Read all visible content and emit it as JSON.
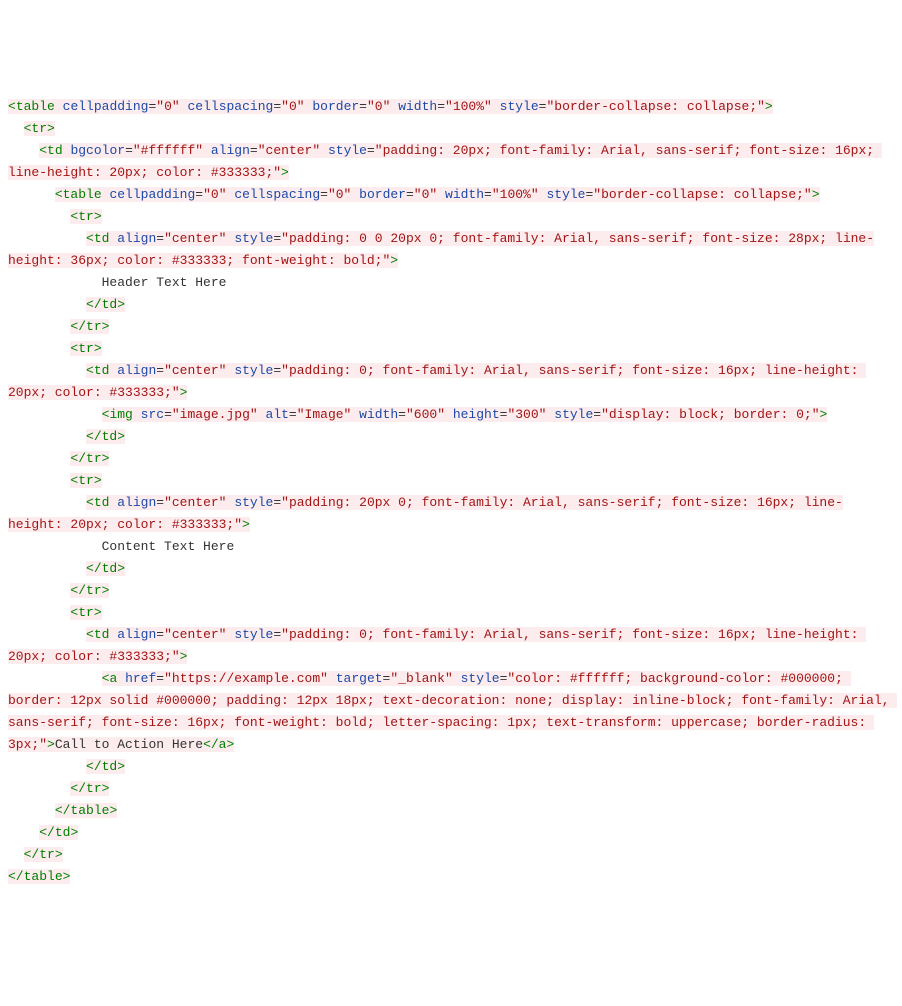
{
  "code": {
    "lines": [
      {
        "i": "",
        "p": [
          [
            "hl",
            "<",
            "tag"
          ],
          [
            "hl",
            "table",
            "tag"
          ],
          [
            "hl",
            " ",
            "txt"
          ],
          [
            "hl",
            "cellpadding",
            "attr"
          ],
          [
            "hl",
            "=",
            "txt"
          ],
          [
            "hl",
            "\"0\"",
            "val"
          ],
          [
            "hl",
            " ",
            "txt"
          ],
          [
            "hl",
            "cellspacing",
            "attr"
          ],
          [
            "hl",
            "=",
            "txt"
          ],
          [
            "hl",
            "\"0\"",
            "val"
          ],
          [
            "hl",
            " ",
            "txt"
          ],
          [
            "hl",
            "border",
            "attr"
          ],
          [
            "hl",
            "=",
            "txt"
          ],
          [
            "hl",
            "\"0\"",
            "val"
          ],
          [
            "hl",
            " ",
            "txt"
          ],
          [
            "hl",
            "width",
            "attr"
          ],
          [
            "hl",
            "=",
            "txt"
          ],
          [
            "hl",
            "\"100%\"",
            "val"
          ],
          [
            "hl",
            " ",
            "txt"
          ],
          [
            "hl",
            "style",
            "attr"
          ],
          [
            "hl",
            "=",
            "txt"
          ],
          [
            "hl",
            "\"border-collapse: collapse;\"",
            "val"
          ],
          [
            "hl",
            ">",
            "tag"
          ]
        ]
      },
      {
        "i": "  ",
        "p": [
          [
            "hl",
            "<",
            "tag"
          ],
          [
            "hl",
            "tr",
            "tag"
          ],
          [
            "hl",
            ">",
            "tag"
          ]
        ]
      },
      {
        "i": "    ",
        "p": [
          [
            "hl",
            "<",
            "tag"
          ],
          [
            "hl",
            "td",
            "tag"
          ],
          [
            "hl",
            " ",
            "txt"
          ],
          [
            "hl",
            "bgcolor",
            "attr"
          ],
          [
            "hl",
            "=",
            "txt"
          ],
          [
            "hl",
            "\"#ffffff\"",
            "val"
          ],
          [
            "hl",
            " ",
            "txt"
          ],
          [
            "hl",
            "align",
            "attr"
          ],
          [
            "hl",
            "=",
            "txt"
          ],
          [
            "hl",
            "\"center\"",
            "val"
          ],
          [
            "hl",
            " ",
            "txt"
          ],
          [
            "hl",
            "style",
            "attr"
          ],
          [
            "hl",
            "=",
            "txt"
          ],
          [
            "hl",
            "\"padding: 20px; font-family: Arial, sans-serif; font-size: 16px; line-height: 20px; color: #333333;\"",
            "val"
          ],
          [
            "hl",
            ">",
            "tag"
          ]
        ]
      },
      {
        "i": "      ",
        "p": [
          [
            "hl",
            "<",
            "tag"
          ],
          [
            "hl",
            "table",
            "tag"
          ],
          [
            "hl",
            " ",
            "txt"
          ],
          [
            "hl",
            "cellpadding",
            "attr"
          ],
          [
            "hl",
            "=",
            "txt"
          ],
          [
            "hl",
            "\"0\"",
            "val"
          ],
          [
            "hl",
            " ",
            "txt"
          ],
          [
            "hl",
            "cellspacing",
            "attr"
          ],
          [
            "hl",
            "=",
            "txt"
          ],
          [
            "hl",
            "\"0\"",
            "val"
          ],
          [
            "hl",
            " ",
            "txt"
          ],
          [
            "hl",
            "border",
            "attr"
          ],
          [
            "hl",
            "=",
            "txt"
          ],
          [
            "hl",
            "\"0\"",
            "val"
          ],
          [
            "hl",
            " ",
            "txt"
          ],
          [
            "hl",
            "width",
            "attr"
          ],
          [
            "hl",
            "=",
            "txt"
          ],
          [
            "hl",
            "\"100%\"",
            "val"
          ],
          [
            "hl",
            " ",
            "txt"
          ],
          [
            "hl",
            "style",
            "attr"
          ],
          [
            "hl",
            "=",
            "txt"
          ],
          [
            "hl",
            "\"border-collapse: collapse;\"",
            "val"
          ],
          [
            "hl",
            ">",
            "tag"
          ]
        ]
      },
      {
        "i": "        ",
        "p": [
          [
            "hl",
            "<",
            "tag"
          ],
          [
            "hl",
            "tr",
            "tag"
          ],
          [
            "hl",
            ">",
            "tag"
          ]
        ]
      },
      {
        "i": "          ",
        "p": [
          [
            "hl",
            "<",
            "tag"
          ],
          [
            "hl",
            "td",
            "tag"
          ],
          [
            "hl",
            " ",
            "txt"
          ],
          [
            "hl",
            "align",
            "attr"
          ],
          [
            "hl",
            "=",
            "txt"
          ],
          [
            "hl",
            "\"center\"",
            "val"
          ],
          [
            "hl",
            " ",
            "txt"
          ],
          [
            "hl",
            "style",
            "attr"
          ],
          [
            "hl",
            "=",
            "txt"
          ],
          [
            "hl",
            "\"padding: 0 0 20px 0; font-family: Arial, sans-serif; font-size: 28px; line-height: 36px; color: #333333; font-weight: bold;\"",
            "val"
          ],
          [
            "hl",
            ">",
            "tag"
          ]
        ]
      },
      {
        "i": "            ",
        "p": [
          [
            "",
            "Header Text Here",
            "txt"
          ]
        ]
      },
      {
        "i": "          ",
        "p": [
          [
            "hl",
            "</",
            "tag"
          ],
          [
            "hl",
            "td",
            "tag"
          ],
          [
            "hl",
            ">",
            "tag"
          ]
        ]
      },
      {
        "i": "        ",
        "p": [
          [
            "hl",
            "</",
            "tag"
          ],
          [
            "hl",
            "tr",
            "tag"
          ],
          [
            "hl",
            ">",
            "tag"
          ]
        ]
      },
      {
        "i": "        ",
        "p": [
          [
            "hl",
            "<",
            "tag"
          ],
          [
            "hl",
            "tr",
            "tag"
          ],
          [
            "hl",
            ">",
            "tag"
          ]
        ]
      },
      {
        "i": "          ",
        "p": [
          [
            "hl",
            "<",
            "tag"
          ],
          [
            "hl",
            "td",
            "tag"
          ],
          [
            "hl",
            " ",
            "txt"
          ],
          [
            "hl",
            "align",
            "attr"
          ],
          [
            "hl",
            "=",
            "txt"
          ],
          [
            "hl",
            "\"center\"",
            "val"
          ],
          [
            "hl",
            " ",
            "txt"
          ],
          [
            "hl",
            "style",
            "attr"
          ],
          [
            "hl",
            "=",
            "txt"
          ],
          [
            "hl",
            "\"padding: 0; font-family: Arial, sans-serif; font-size: 16px; line-height: 20px; color: #333333;\"",
            "val"
          ],
          [
            "hl",
            ">",
            "tag"
          ]
        ]
      },
      {
        "i": "            ",
        "p": [
          [
            "hl",
            "<",
            "tag"
          ],
          [
            "hl",
            "img",
            "tag"
          ],
          [
            "hl",
            " ",
            "txt"
          ],
          [
            "hl",
            "src",
            "attr"
          ],
          [
            "hl",
            "=",
            "txt"
          ],
          [
            "hl",
            "\"image.jpg\"",
            "val"
          ],
          [
            "hl",
            " ",
            "txt"
          ],
          [
            "hl",
            "alt",
            "attr"
          ],
          [
            "hl",
            "=",
            "txt"
          ],
          [
            "hl",
            "\"Image\"",
            "val"
          ],
          [
            "hl",
            " ",
            "txt"
          ],
          [
            "hl",
            "width",
            "attr"
          ],
          [
            "hl",
            "=",
            "txt"
          ],
          [
            "hl",
            "\"600\"",
            "val"
          ],
          [
            "hl",
            " ",
            "txt"
          ],
          [
            "hl",
            "height",
            "attr"
          ],
          [
            "hl",
            "=",
            "txt"
          ],
          [
            "hl",
            "\"300\"",
            "val"
          ],
          [
            "hl",
            " ",
            "txt"
          ],
          [
            "hl",
            "style",
            "attr"
          ],
          [
            "hl",
            "=",
            "txt"
          ],
          [
            "hl",
            "\"display: block; border: 0;\"",
            "val"
          ],
          [
            "hl",
            ">",
            "tag"
          ]
        ]
      },
      {
        "i": "          ",
        "p": [
          [
            "hl",
            "</",
            "tag"
          ],
          [
            "hl",
            "td",
            "tag"
          ],
          [
            "hl",
            ">",
            "tag"
          ]
        ]
      },
      {
        "i": "        ",
        "p": [
          [
            "hl",
            "</",
            "tag"
          ],
          [
            "hl",
            "tr",
            "tag"
          ],
          [
            "hl",
            ">",
            "tag"
          ]
        ]
      },
      {
        "i": "        ",
        "p": [
          [
            "hl",
            "<",
            "tag"
          ],
          [
            "hl",
            "tr",
            "tag"
          ],
          [
            "hl",
            ">",
            "tag"
          ]
        ]
      },
      {
        "i": "          ",
        "p": [
          [
            "hl",
            "<",
            "tag"
          ],
          [
            "hl",
            "td",
            "tag"
          ],
          [
            "hl",
            " ",
            "txt"
          ],
          [
            "hl",
            "align",
            "attr"
          ],
          [
            "hl",
            "=",
            "txt"
          ],
          [
            "hl",
            "\"center\"",
            "val"
          ],
          [
            "hl",
            " ",
            "txt"
          ],
          [
            "hl",
            "style",
            "attr"
          ],
          [
            "hl",
            "=",
            "txt"
          ],
          [
            "hl",
            "\"padding: 20px 0; font-family: Arial, sans-serif; font-size: 16px; line-height: 20px; color: #333333;\"",
            "val"
          ],
          [
            "hl",
            ">",
            "tag"
          ]
        ]
      },
      {
        "i": "            ",
        "p": [
          [
            "",
            "Content Text Here",
            "txt"
          ]
        ]
      },
      {
        "i": "          ",
        "p": [
          [
            "hl",
            "</",
            "tag"
          ],
          [
            "hl",
            "td",
            "tag"
          ],
          [
            "hl",
            ">",
            "tag"
          ]
        ]
      },
      {
        "i": "        ",
        "p": [
          [
            "hl",
            "</",
            "tag"
          ],
          [
            "hl",
            "tr",
            "tag"
          ],
          [
            "hl",
            ">",
            "tag"
          ]
        ]
      },
      {
        "i": "        ",
        "p": [
          [
            "hl",
            "<",
            "tag"
          ],
          [
            "hl",
            "tr",
            "tag"
          ],
          [
            "hl",
            ">",
            "tag"
          ]
        ]
      },
      {
        "i": "          ",
        "p": [
          [
            "hl",
            "<",
            "tag"
          ],
          [
            "hl",
            "td",
            "tag"
          ],
          [
            "hl",
            " ",
            "txt"
          ],
          [
            "hl",
            "align",
            "attr"
          ],
          [
            "hl",
            "=",
            "txt"
          ],
          [
            "hl",
            "\"center\"",
            "val"
          ],
          [
            "hl",
            " ",
            "txt"
          ],
          [
            "hl",
            "style",
            "attr"
          ],
          [
            "hl",
            "=",
            "txt"
          ],
          [
            "hl",
            "\"padding: 0; font-family: Arial, sans-serif; font-size: 16px; line-height: 20px; color: #333333;\"",
            "val"
          ],
          [
            "hl",
            ">",
            "tag"
          ]
        ]
      },
      {
        "i": "            ",
        "p": [
          [
            "hl",
            "<",
            "tag"
          ],
          [
            "hl",
            "a",
            "tag"
          ],
          [
            "hl",
            " ",
            "txt"
          ],
          [
            "hl",
            "href",
            "attr"
          ],
          [
            "hl",
            "=",
            "txt"
          ],
          [
            "hl",
            "\"https://example.com\"",
            "val"
          ],
          [
            "hl",
            " ",
            "txt"
          ],
          [
            "hl",
            "target",
            "attr"
          ],
          [
            "hl",
            "=",
            "txt"
          ],
          [
            "hl",
            "\"_blank\"",
            "val"
          ],
          [
            "hl",
            " ",
            "txt"
          ],
          [
            "hl",
            "style",
            "attr"
          ],
          [
            "hl",
            "=",
            "txt"
          ],
          [
            "hl",
            "\"color: #ffffff; background-color: #000000; border: 12px solid #000000; padding: 12px 18px; text-decoration: none; display: inline-block; font-family: Arial, sans-serif; font-size: 16px; font-weight: bold; letter-spacing: 1px; text-transform: uppercase; border-radius: 3px;\"",
            "val"
          ],
          [
            "hl",
            ">",
            "tag"
          ],
          [
            "hl",
            "Call to Action Here",
            "txt"
          ],
          [
            "hl",
            "</",
            "tag"
          ],
          [
            "hl",
            "a",
            "tag"
          ],
          [
            "hl",
            ">",
            "tag"
          ]
        ]
      },
      {
        "i": "          ",
        "p": [
          [
            "hl",
            "</",
            "tag"
          ],
          [
            "hl",
            "td",
            "tag"
          ],
          [
            "hl",
            ">",
            "tag"
          ]
        ]
      },
      {
        "i": "        ",
        "p": [
          [
            "hl",
            "</",
            "tag"
          ],
          [
            "hl",
            "tr",
            "tag"
          ],
          [
            "hl",
            ">",
            "tag"
          ]
        ]
      },
      {
        "i": "      ",
        "p": [
          [
            "hl",
            "</",
            "tag"
          ],
          [
            "hl",
            "table",
            "tag"
          ],
          [
            "hl",
            ">",
            "tag"
          ]
        ]
      },
      {
        "i": "    ",
        "p": [
          [
            "hl",
            "</",
            "tag"
          ],
          [
            "hl",
            "td",
            "tag"
          ],
          [
            "hl",
            ">",
            "tag"
          ]
        ]
      },
      {
        "i": "  ",
        "p": [
          [
            "hl",
            "</",
            "tag"
          ],
          [
            "hl",
            "tr",
            "tag"
          ],
          [
            "hl",
            ">",
            "tag"
          ]
        ]
      },
      {
        "i": "",
        "p": [
          [
            "hl",
            "</",
            "tag"
          ],
          [
            "hl",
            "table",
            "tag"
          ],
          [
            "hl",
            ">",
            "tag"
          ]
        ]
      }
    ]
  }
}
